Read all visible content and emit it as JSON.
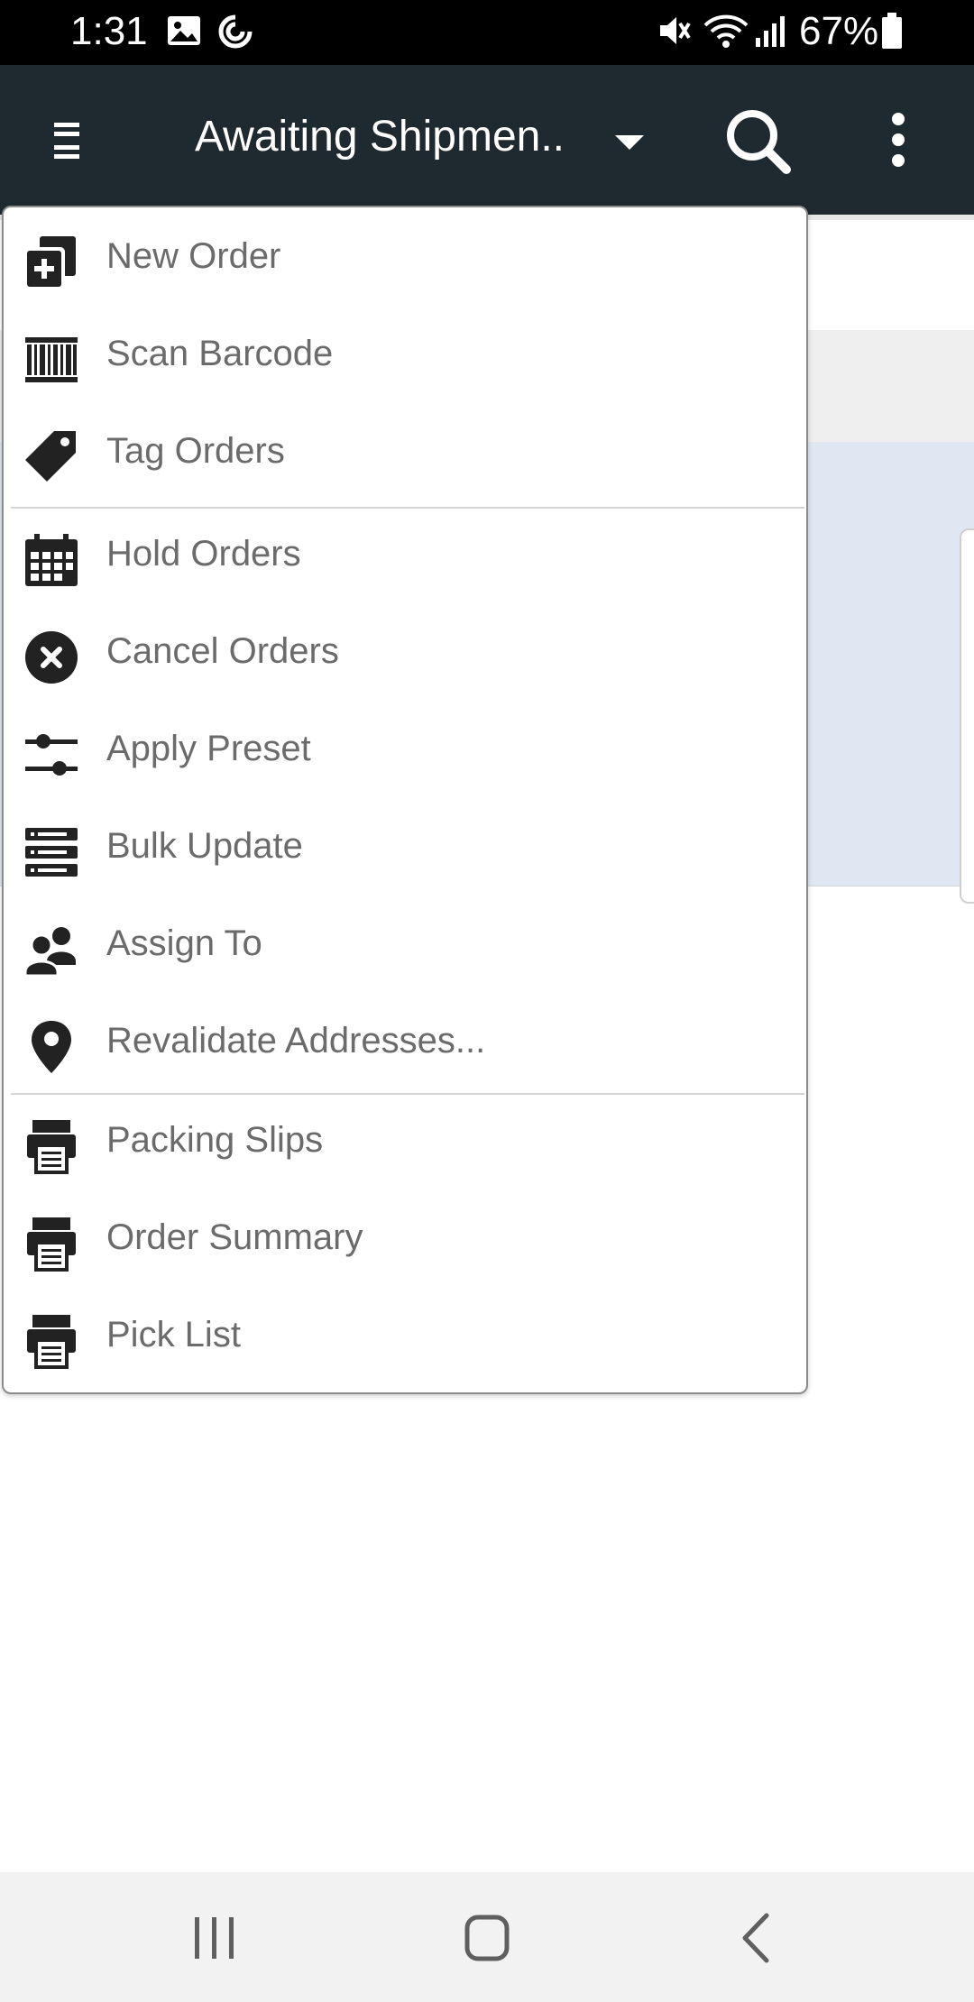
{
  "status_bar": {
    "time": "1:31",
    "battery_percent": "67%",
    "icons": [
      "image-icon",
      "sync-icon",
      "mute-icon",
      "wifi-icon",
      "signal-icon",
      "battery-icon"
    ]
  },
  "toolbar": {
    "title": "Awaiting Shipmen..",
    "icons": [
      "menu-icon",
      "dropdown-arrow-icon",
      "search-icon",
      "more-vert-icon"
    ]
  },
  "menu": {
    "items": [
      {
        "label": "New Order",
        "icon": "new-order-icon"
      },
      {
        "label": "Scan Barcode",
        "icon": "barcode-icon"
      },
      {
        "label": "Tag Orders",
        "icon": "tag-icon"
      },
      {
        "label": "Hold Orders",
        "icon": "calendar-icon"
      },
      {
        "label": "Cancel Orders",
        "icon": "cancel-icon"
      },
      {
        "label": "Apply Preset",
        "icon": "sliders-icon"
      },
      {
        "label": "Bulk Update",
        "icon": "bulk-update-icon"
      },
      {
        "label": "Assign To",
        "icon": "users-icon"
      },
      {
        "label": "Revalidate Addresses...",
        "icon": "map-pin-icon"
      },
      {
        "label": "Packing Slips",
        "icon": "printer-icon"
      },
      {
        "label": "Order Summary",
        "icon": "printer-icon"
      },
      {
        "label": "Pick List",
        "icon": "printer-icon"
      }
    ]
  },
  "nav_bar": {
    "icons": [
      "recent-apps-icon",
      "home-icon",
      "back-icon"
    ]
  },
  "colors": {
    "toolbar_bg": "#1f2a30",
    "menu_text": "#6b6b6b",
    "selected_row_bg": "#dfe8f2"
  }
}
